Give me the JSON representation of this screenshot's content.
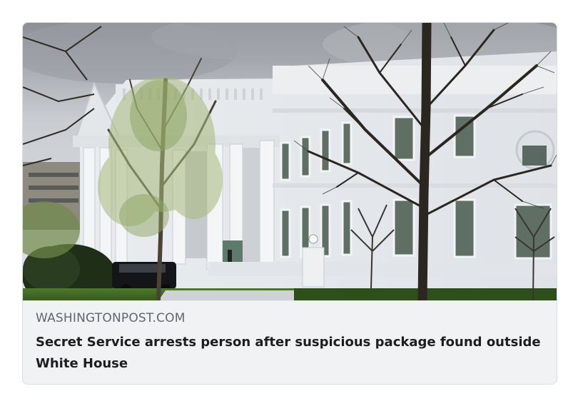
{
  "link_preview": {
    "domain": "WASHINGTONPOST.COM",
    "title": "Secret Service arrests person after suspicious package found outside White House",
    "image_icon": "white-house-photo"
  },
  "colors": {
    "card_background": "#f1f2f4",
    "domain_text": "#606770",
    "title_text": "#1c1e21",
    "border": "#dadde1"
  }
}
